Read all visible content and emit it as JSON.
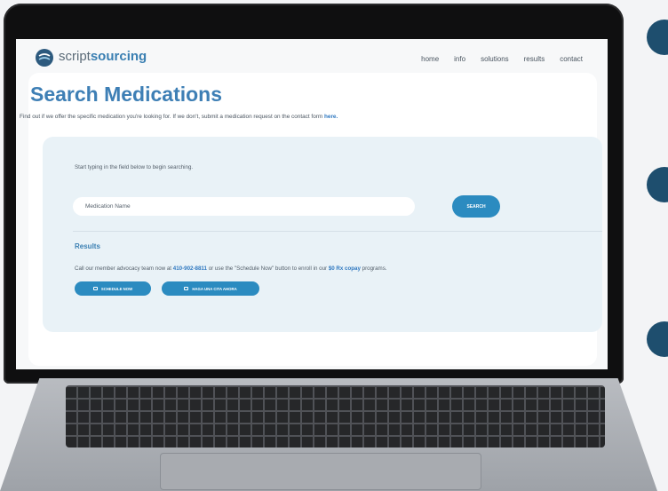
{
  "brand": {
    "prefix": "script",
    "suffix": "sourcing"
  },
  "nav": {
    "items": [
      "home",
      "info",
      "solutions",
      "results",
      "contact"
    ]
  },
  "page": {
    "title": "Search Medications",
    "subtitle": "Find out if we offer the specific medication you're looking for. If we don't, submit a medication request on the contact form",
    "subtitle_link": "here."
  },
  "search": {
    "hint": "Start typing in the field below to begin searching.",
    "placeholder": "Medication Name",
    "button": "SEARCH"
  },
  "results": {
    "title": "Results",
    "text_before": "Call our member advocacy team now at",
    "phone": "410-902-8811",
    "text_middle": "or use the \"Schedule Now\" button to enroll in our",
    "program": "$0 Rx copay",
    "text_after": "programs.",
    "buttons": [
      "SCHEDULE NOW",
      "HAGA UNA CITA AHORA"
    ]
  },
  "colors": {
    "accent": "#3e7fb5",
    "button": "#2b8bc0",
    "panel": "#e9f2f7",
    "dark_circle": "#1e4e6e"
  }
}
